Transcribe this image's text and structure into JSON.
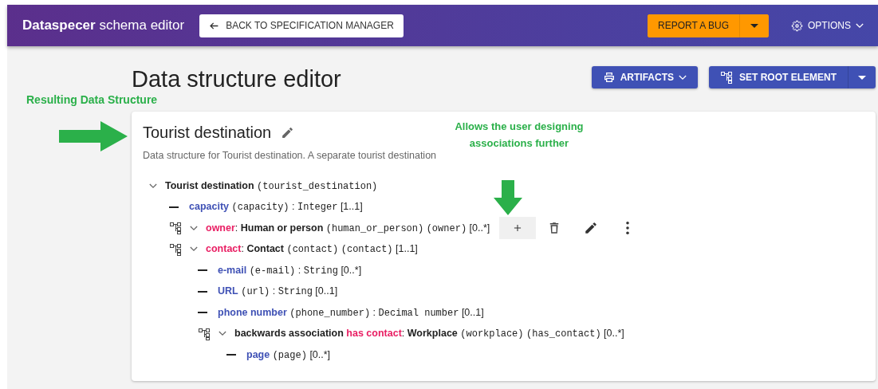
{
  "header": {
    "title": "**Dataspecer** schema editor",
    "back_button": "BACK TO SPECIFICATION MANAGER",
    "report_button": "REPORT A BUG",
    "options_button": "OPTIONS"
  },
  "page": {
    "title": "Data structure editor",
    "toolbar": [
      {
        "kind": "artifacts",
        "label": "ARTIFACTS"
      },
      {
        "kind": "root",
        "label": "SET ROOT ELEMENT"
      }
    ]
  },
  "card": {
    "title": "Tourist destination",
    "description": "Data structure for Tourist destination. A separate tourist destination",
    "tree": {
      "kind": "root",
      "expanded": true,
      "class": "Tourist destination",
      "class_code": "(tourist_destination)",
      "children": [
        {
          "kind": "attribute",
          "name": "capacity",
          "code": "(capacity)",
          "separator": ":",
          "type": "Integer",
          "cardinality": "[1..1]"
        },
        {
          "kind": "association",
          "expanded": true,
          "name": "owner",
          "separator": ":",
          "class": "Human or person",
          "class_code": "(human_or_person)",
          "code": "(owner)",
          "cardinality": "[0..*]",
          "actions": [
            {
              "kind": "add",
              "highlighted": true
            },
            {
              "kind": "delete",
              "highlighted": false
            },
            {
              "kind": "edit",
              "highlighted": false
            },
            {
              "kind": "more",
              "highlighted": false
            }
          ]
        },
        {
          "kind": "association",
          "expanded": true,
          "name": "contact",
          "separator": ":",
          "class": "Contact",
          "class_code": "(contact)",
          "code": "(contact)",
          "cardinality": "[1..1]",
          "children": [
            {
              "kind": "attribute",
              "name": "e-mail",
              "code": "(e-mail)",
              "separator": ":",
              "type": "String",
              "cardinality": "[0..*]"
            },
            {
              "kind": "attribute",
              "name": "URL",
              "code": "(url)",
              "separator": ":",
              "type": "String",
              "cardinality": "[0..1]"
            },
            {
              "kind": "attribute",
              "name": "phone number",
              "code": "(phone_number)",
              "separator": ":",
              "type": "Decimal number",
              "cardinality": "[0..1]"
            },
            {
              "kind": "association",
              "expanded": true,
              "prefix": "backwards association",
              "name": "has contact",
              "separator": ":",
              "class": "Workplace",
              "class_code": "(workplace)",
              "code": "(has_contact)",
              "cardinality": "[0..*]",
              "children": [
                {
                  "kind": "attribute",
                  "name": "page",
                  "code": "(page)",
                  "cardinality": "[0..*]"
                }
              ]
            }
          ]
        }
      ]
    }
  },
  "annotations": [
    {
      "kind": "label",
      "text": "Resulting Data Structure"
    },
    {
      "kind": "arrow-right"
    },
    {
      "kind": "callout",
      "text": "Allows the user designing associations further"
    },
    {
      "kind": "arrow-down"
    }
  ]
}
